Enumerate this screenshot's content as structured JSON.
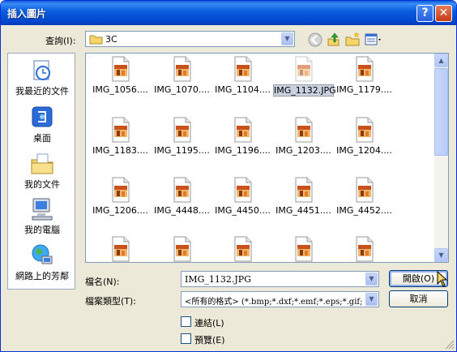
{
  "window": {
    "title": "插入圖片"
  },
  "lookin": {
    "label": "查詢(I):",
    "value": "3C"
  },
  "places": [
    {
      "label": "我最近的文件",
      "icon": "recent-documents-icon"
    },
    {
      "label": "桌面",
      "icon": "desktop-icon"
    },
    {
      "label": "我的文件",
      "icon": "my-documents-icon"
    },
    {
      "label": "我的電腦",
      "icon": "my-computer-icon"
    },
    {
      "label": "網路上的芳鄰",
      "icon": "network-places-icon"
    }
  ],
  "files": [
    {
      "name": "IMG_1056...."
    },
    {
      "name": "IMG_1070...."
    },
    {
      "name": "IMG_1104...."
    },
    {
      "name": "IMG_1132.JPG",
      "selected": true
    },
    {
      "name": "IMG_1179...."
    },
    {
      "name": "IMG_1183...."
    },
    {
      "name": "IMG_1195...."
    },
    {
      "name": "IMG_1196...."
    },
    {
      "name": "IMG_1203...."
    },
    {
      "name": "IMG_1204...."
    },
    {
      "name": "IMG_1206...."
    },
    {
      "name": "IMG_4448...."
    },
    {
      "name": "IMG_4450...."
    },
    {
      "name": "IMG_4451...."
    },
    {
      "name": "IMG_4452...."
    },
    {
      "name": ""
    },
    {
      "name": ""
    },
    {
      "name": ""
    },
    {
      "name": ""
    },
    {
      "name": ""
    }
  ],
  "filename": {
    "label": "檔名(N):",
    "value": "IMG_1132.JPG"
  },
  "filetype": {
    "label": "檔案類型(T):",
    "value": "<所有的格式> (*.bmp;*.dxf;*.emf;*.eps;*.gif;"
  },
  "buttons": {
    "open": "開啟(O)",
    "cancel": "取消"
  },
  "options": {
    "link": "連結(L)",
    "preview": "預覽(E)"
  },
  "colors": {
    "titlebar": "#0054e3",
    "selection": "#c9d2e0",
    "folder": "#f5d66b"
  }
}
